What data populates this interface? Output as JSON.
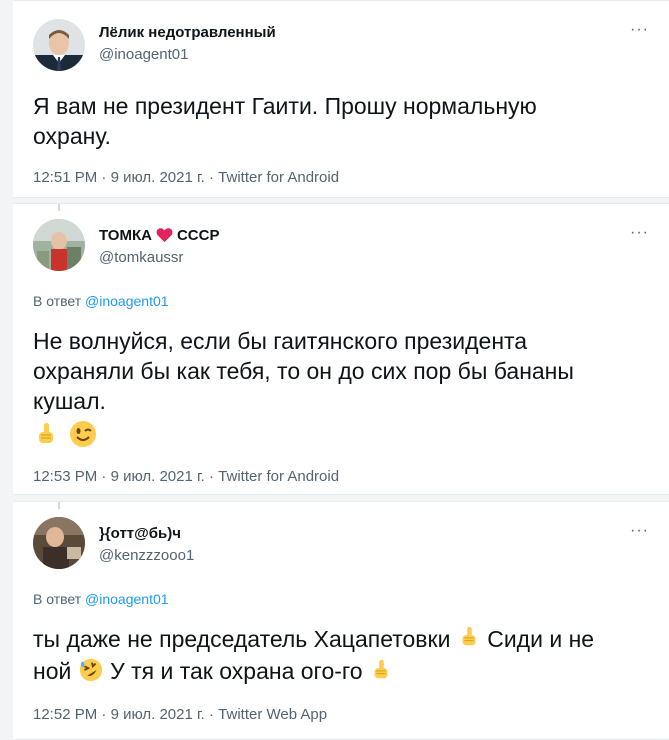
{
  "tweets": [
    {
      "name": "Лёлик недотравленный",
      "handle": "@inoagent01",
      "text_line1": "Я вам не президент Гаити. Прошу нормальную",
      "text_line2": "охрану.",
      "time": "12:51 PM",
      "date": "9 июл. 2021 г.",
      "source": "Twitter for Android",
      "more": "···"
    },
    {
      "name_left": "ТОМКА",
      "name_right": "СССР",
      "handle": "@tomkaussr",
      "reply_prefix": "В ответ",
      "reply_to": "@inoagent01",
      "text_line1": "Не волнуйся, если бы гаитянского президента",
      "text_line2": "охраняли бы как тебя, то он до сих  пор бы бананы",
      "text_line3": "кушал.",
      "time": "12:53 PM",
      "date": "9 июл. 2021 г.",
      "source": "Twitter for Android",
      "more": "···",
      "emojis": [
        "pointing-up-emoji",
        "winking-face-emoji"
      ]
    },
    {
      "name": "}{отт@бь)ч",
      "handle": "@kenzzzooo1",
      "reply_prefix": "В ответ",
      "reply_to": "@inoagent01",
      "text_part1": "ты даже не председатель Хацапетовки",
      "text_part2": "Сиди и не",
      "text_part3": "ной",
      "text_part4": "У тя и так охрана ого-го",
      "time": "12:52 PM",
      "date": "9 июл. 2021 г.",
      "source": "Twitter Web App",
      "more": "···",
      "emojis": [
        "pointing-up-emoji",
        "rolling-laughing-emoji",
        "pointing-up-emoji"
      ]
    }
  ],
  "meta_separator": " · ",
  "colors": {
    "accent": "#1d9bf0",
    "secondary_text": "#536471",
    "heart": "#e0245e"
  }
}
